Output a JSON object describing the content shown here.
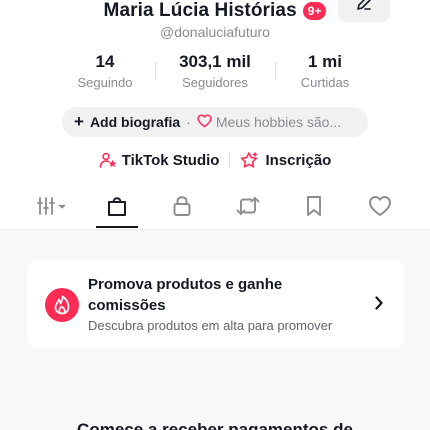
{
  "profile": {
    "display_name": "Maria Lúcia Histórias",
    "notification_badge": "9+",
    "username": "@donaluciafuturo"
  },
  "stats": [
    {
      "value": "14",
      "label": "Seguindo"
    },
    {
      "value": "303,1 mil",
      "label": "Seguidores"
    },
    {
      "value": "1 mi",
      "label": "Curtidas"
    }
  ],
  "bio": {
    "add_label": "Add biografia",
    "separator": "·",
    "hobby_text": "Meus hobbies são..."
  },
  "links": {
    "studio": "TikTok Studio",
    "subscription": "Inscrição"
  },
  "tabs": [
    {
      "icon": "grid-icon",
      "active": false
    },
    {
      "icon": "shopping-bag-icon",
      "active": true
    },
    {
      "icon": "lock-icon",
      "active": false
    },
    {
      "icon": "repost-icon",
      "active": false
    },
    {
      "icon": "bookmark-icon",
      "active": false
    },
    {
      "icon": "heart-icon",
      "active": false
    }
  ],
  "promo": {
    "title": "Promova produtos e ganhe comissões",
    "subtitle": "Descubra produtos em alta para promover"
  },
  "bottom_heading": "Comece a receber pagamentos de",
  "colors": {
    "accent": "#fe2c55",
    "text": "#161823",
    "muted": "#8a8b91",
    "pill_bg": "#f1f1f2"
  }
}
